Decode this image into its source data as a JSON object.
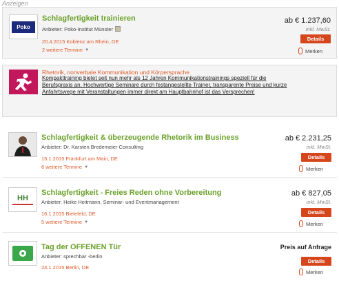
{
  "ads_label": "Anzeigen",
  "listings": [
    {
      "title": "Schlagfertigkeit trainieren",
      "provider": "Anbieter: Poko-Institut Münster",
      "date_location": "20.4.2015 Koblenz am Rhein, DE",
      "more_dates": "2 weitere Termine",
      "price": "ab € 1.237,60",
      "tax": "inkl. MwSt.",
      "details_label": "Details",
      "merken_label": "Merken",
      "logo_text": "Poko"
    },
    {
      "title": "Schlagfertigkeit & überzeugende Rhetorik im Business",
      "provider": "Anbieter: Dr. Karsten Bredemeier Consulting",
      "date_location": "15.1.2015 Frankfurt am Main, DE",
      "more_dates": "6 weitere Termine",
      "price": "ab € 2.231,25",
      "tax": "inkl. MwSt.",
      "details_label": "Details",
      "merken_label": "Merken"
    },
    {
      "title": "Schlagfertigkeit - Freies Reden ohne Vorbereitung",
      "provider": "Anbieter: Heike Heitmann, Seminar- und Eventmanagement",
      "date_location": "16.1.2015 Bielefeld, DE",
      "more_dates": "5 weitere Termine",
      "price": "ab € 827,05",
      "tax": "inkl. MwSt.",
      "details_label": "Details",
      "merken_label": "Merken",
      "logo_text": "HH"
    },
    {
      "title": "Tag der OFFENEN Tür",
      "provider": "Anbieter: sprechbar -berlin",
      "date_location": "24.1.2015 Berlin, DE",
      "price": "Preis auf Anfrage",
      "details_label": "Details",
      "merken_label": "Merken"
    }
  ],
  "promo": {
    "title": "Rhetorik, nonverbale Kommunikation und Körpersprache",
    "text": "Kompakttraining bietet seit nun mehr als 12 Jahren Kommunikationstrainings speziell für die Berufspraxis an. Hochwertige Seminare durch festangestellte Trainer, transparente Preise und kurze Anfahrtswege mit Veranstaltungen immer direkt am Hauptbahnhof ist das Versprechen!"
  },
  "colors": {
    "title_green": "#6aa12a",
    "accent_orange": "#e05a2b",
    "button_red": "#d6461d"
  }
}
